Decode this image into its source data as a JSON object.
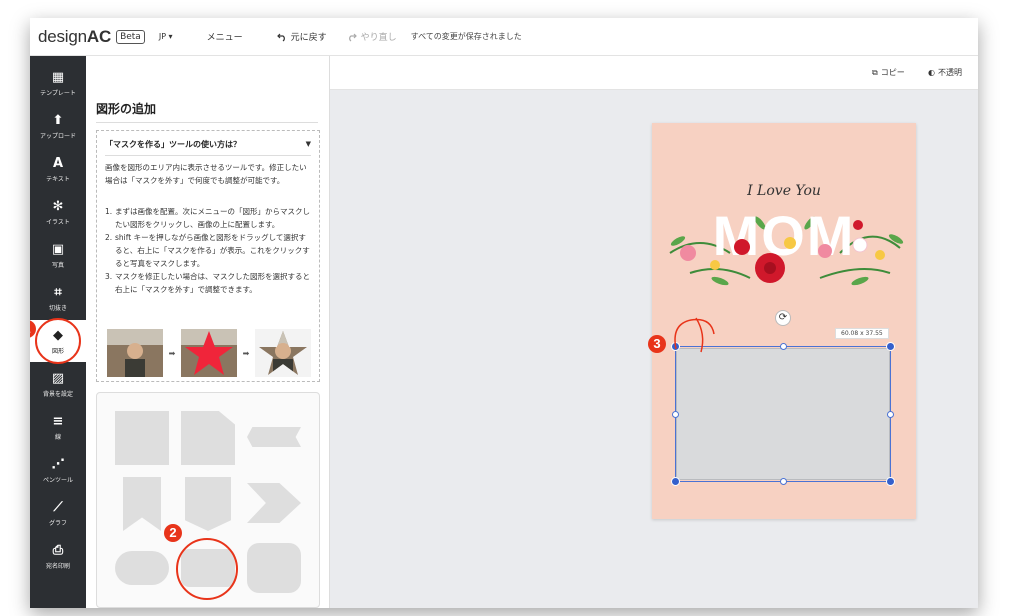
{
  "app": {
    "logo_prefix": "design",
    "logo_suffix": "AC",
    "beta": "Beta",
    "lang": "JP ▾",
    "menu": "メニュー",
    "undo": "元に戻す",
    "redo": "やり直し",
    "saved_status": "すべての変更が保存されました"
  },
  "rail": {
    "items": [
      {
        "label": "テンプレート",
        "icon": "▦"
      },
      {
        "label": "アップロード",
        "icon": "⬆"
      },
      {
        "label": "テキスト",
        "icon": "A"
      },
      {
        "label": "イラスト",
        "icon": "✻"
      },
      {
        "label": "写真",
        "icon": "▣"
      },
      {
        "label": "切抜き",
        "icon": "⌗"
      },
      {
        "label": "図形",
        "icon": "◆"
      },
      {
        "label": "背景を設定",
        "icon": "▨"
      },
      {
        "label": "線",
        "icon": "≡"
      },
      {
        "label": "ペンツール",
        "icon": "⋰"
      },
      {
        "label": "グラフ",
        "icon": "⟋"
      },
      {
        "label": "宛名印刷",
        "icon": "⎙"
      }
    ]
  },
  "panel": {
    "title": "図形の追加",
    "help_title": "「マスクを作る」ツールの使い方は？",
    "help_intro": "画像を図形のエリア内に表示させるツールです。修正したい場合は「マスクを外す」で何度でも調整が可能です。",
    "steps": [
      {
        "num": "1.",
        "text": "まずは画像を配置。次にメニューの「図形」からマスクしたい図形をクリックし、画像の上に配置します。"
      },
      {
        "num": "2.",
        "text": "shift キーを押しながら画像と図形をドラッグして選択すると、右上に「マスクを作る」が表示。これをクリックすると写真をマスクします。"
      },
      {
        "num": "3.",
        "text": "マスクを修正したい場合は、マスクした図形を選択すると右上に「マスクを外す」で調整できます。"
      }
    ]
  },
  "toolbar": {
    "copy": "コピー",
    "opacity": "不透明"
  },
  "canvas": {
    "card_script": "I Love You",
    "card_word": "MOM",
    "dimensions": "60.08 x 37.55",
    "accent": "#4a72d4",
    "card_bg": "#f7d1c2"
  },
  "annotations": {
    "one": "1",
    "two": "2",
    "three": "3",
    "color": "#e8341a"
  }
}
